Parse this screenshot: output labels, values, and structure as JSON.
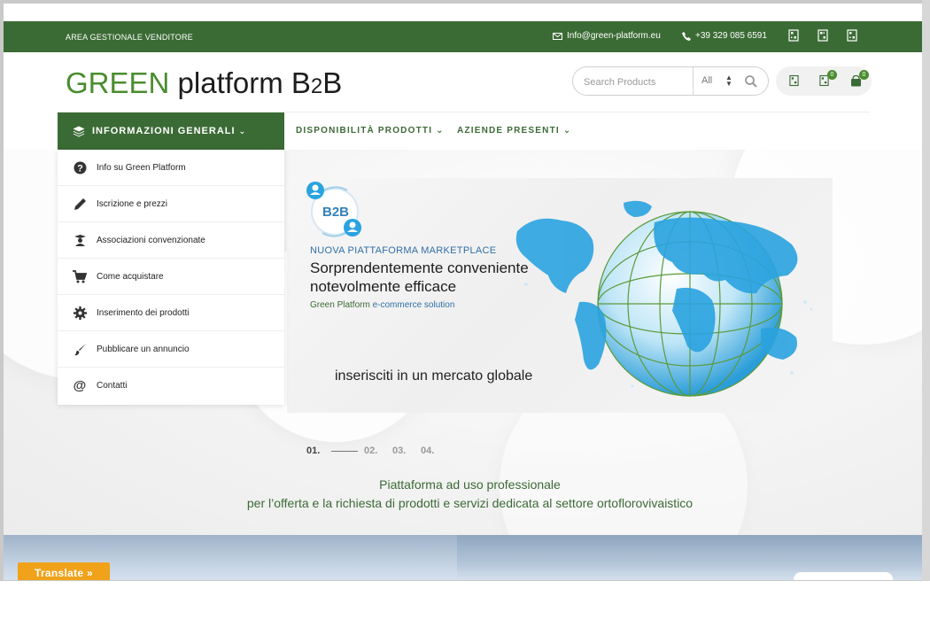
{
  "topbar": {
    "area_label": "AREA GESTIONALE VENDITORE",
    "email": "Info@green-platform.eu",
    "phone": "+39 329 085 6591",
    "icons": [
      "qr-icon",
      "qr-icon",
      "qr-icon"
    ]
  },
  "header": {
    "logo_green": "GREEN",
    "logo_dark": " platform B",
    "logo_two": "2",
    "logo_b": "B",
    "search_placeholder": "Search Products",
    "category_selected": "All",
    "wishlist_count": "0",
    "cart_count": "0"
  },
  "nav": {
    "main": "INFORMAZIONI GENERALI",
    "items": [
      "DISPONIBILITÀ PRODOTTI",
      "AZIENDE PRESENTI"
    ]
  },
  "sidebar": {
    "items": [
      {
        "label": "Info su Green Platform",
        "icon": "question-icon"
      },
      {
        "label": "Iscrizione e prezzi",
        "icon": "pencil-icon"
      },
      {
        "label": "Associazioni convenzionate",
        "icon": "graduate-icon"
      },
      {
        "label": "Come acquistare",
        "icon": "cart-icon"
      },
      {
        "label": "Inserimento dei prodotti",
        "icon": "gear-icon"
      },
      {
        "label": "Pubblicare un annuncio",
        "icon": "brush-icon"
      },
      {
        "label": "Contatti",
        "icon": "at-icon"
      }
    ]
  },
  "banner": {
    "b2b": "B2B",
    "kicker": "NUOVA PIATTAFORMA MARKETPLACE",
    "headline_1": "Sorprendentemente conveniente",
    "headline_2": "notevolmente efficace",
    "solution_a": "Green Platform",
    "solution_b": " e-commerce solution",
    "global": "inserisciti in un mercato globale"
  },
  "slider": {
    "pages": [
      "01.",
      "02.",
      "03.",
      "04."
    ],
    "active": 0
  },
  "tagline": {
    "line1": "Piattaforma ad uso professionale",
    "line2": "per l’offerta e la richiesta di prodotti e servizi dedicata al settore ortoflorovivaistico"
  },
  "translate": {
    "label": "Translate »"
  },
  "colors": {
    "brand_green": "#3b6b35",
    "logo_green": "#4a8d2f",
    "accent_orange": "#f0a21a",
    "globe_blue": "#2aa3e0"
  }
}
